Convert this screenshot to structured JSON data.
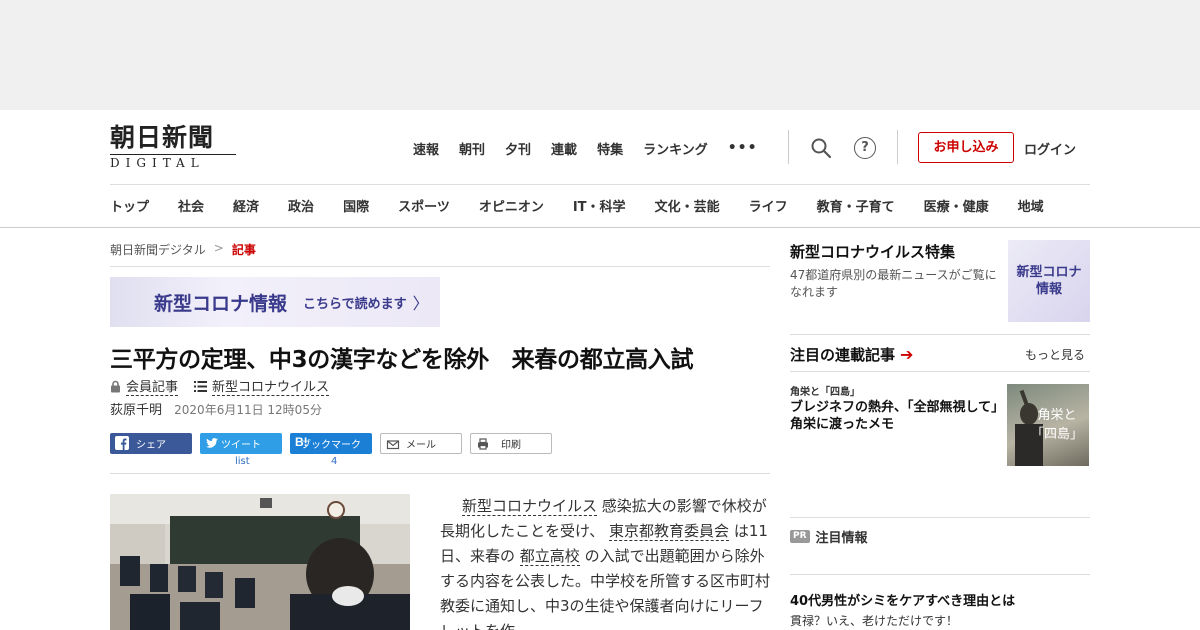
{
  "logo": {
    "main": "朝日新聞",
    "sub": "DIGITAL"
  },
  "topnav": [
    "速報",
    "朝刊",
    "夕刊",
    "連載",
    "特集",
    "ランキング"
  ],
  "more_dots": "•••",
  "header": {
    "apply_label": "お申し込み",
    "login_label": "ログイン",
    "help_label": "?"
  },
  "categories": [
    "トップ",
    "社会",
    "経済",
    "政治",
    "国際",
    "スポーツ",
    "オピニオン",
    "IT・科学",
    "文化・芸能",
    "ライフ",
    "教育・子育て",
    "医療・健康",
    "地域"
  ],
  "breadcrumb": {
    "home": "朝日新聞デジタル",
    "sep": ">",
    "current": "記事"
  },
  "banner": {
    "title": "新型コロナ情報",
    "cta": "こちらで読めます",
    "chevron": "〉"
  },
  "article": {
    "headline": "三平方の定理、中3の漢字などを除外　来春の都立高入試",
    "member": "会員記事",
    "topic": "新型コロナウイルス",
    "author": "荻原千明",
    "date": "2020年6月11日 12時05分",
    "body": {
      "p1": "新型コロナウイルス",
      "p2": " 感染拡大の影響で休校が長期化したことを受け、 ",
      "p3": "東京都教育委員会",
      "p4": " は11日、来春の ",
      "p5": "都立高校",
      "p6": " の入試で出題範囲から除外する内容を公表した。中学校を所管する区市町村教委に通知し、中3の生徒や保護者向けにリーフレットを作"
    }
  },
  "share": {
    "facebook": "シェア",
    "twitter": "ツイート",
    "hatena": "ブックマーク",
    "mail": "メール",
    "print": "印刷",
    "twitter_count": "list",
    "hatena_count": "4"
  },
  "sidebar": {
    "special_title": "新型コロナウイルス特集",
    "special_desc": "47都道府県別の最新ニュースがご覧になれます",
    "special_thumb_1": "新型コロナ",
    "special_thumb_2": "情報",
    "serial_heading": "注目の連載記事",
    "more": "もっと見る",
    "serial_tag": "角栄と「四島」",
    "serial_title": "ブレジネフの熱弁、「全部無視して」　角栄に渡ったメモ",
    "serial_thumb_1": "角栄と",
    "serial_thumb_2": "「四島」",
    "pr_badge": "PR",
    "pr_label": "注目情報",
    "promo_title": "40代男性がシミをケアすべき理由とは",
    "promo_sub": "貫禄？いえ、老けただけです！"
  },
  "colors": {
    "accent": "#cc0000",
    "facebook": "#3b5998",
    "twitter": "#2f9ee6",
    "hatena": "#1c7fd6",
    "banner_text": "#3a3a8c"
  }
}
